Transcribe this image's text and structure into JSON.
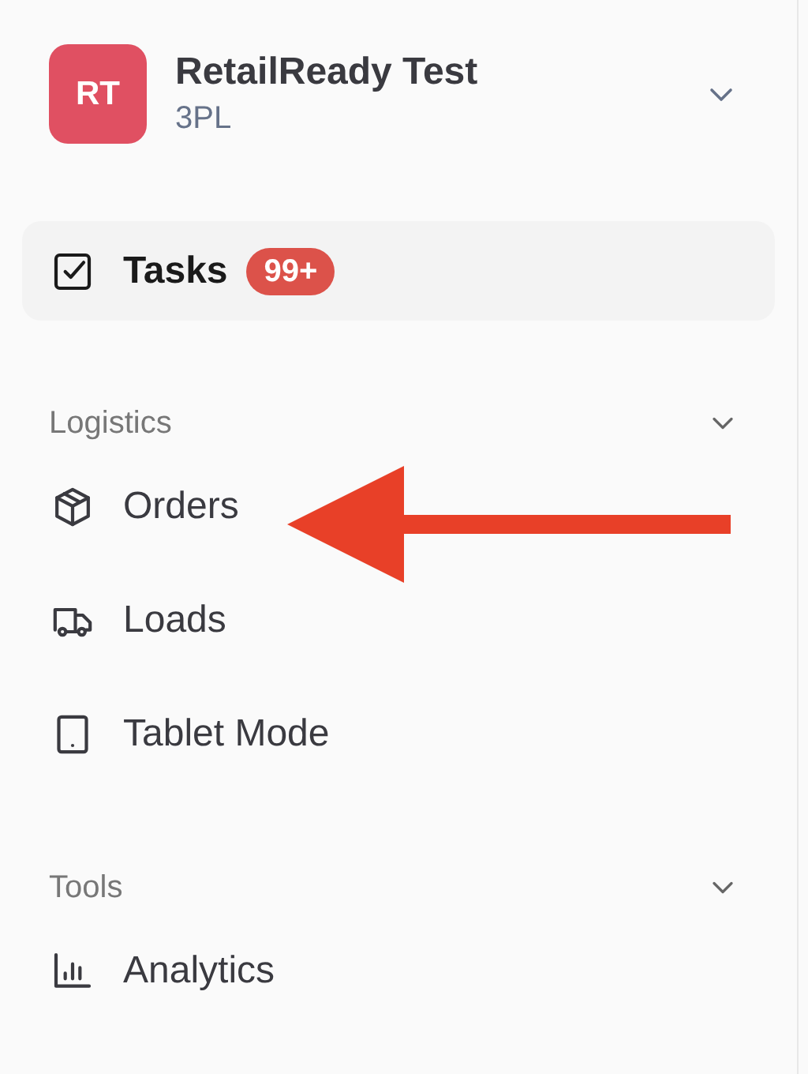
{
  "workspace": {
    "initials": "RT",
    "name": "RetailReady Test",
    "type": "3PL",
    "color": "#e05062"
  },
  "top_items": [
    {
      "label": "Tasks",
      "badge": "99+",
      "selected": true
    }
  ],
  "sections": [
    {
      "title": "Logistics",
      "expanded": true,
      "items": [
        {
          "label": "Orders",
          "selected": false
        },
        {
          "label": "Loads",
          "selected": false
        },
        {
          "label": "Tablet Mode",
          "selected": false
        }
      ]
    },
    {
      "title": "Tools",
      "expanded": true,
      "items": [
        {
          "label": "Analytics",
          "selected": false
        }
      ]
    }
  ]
}
